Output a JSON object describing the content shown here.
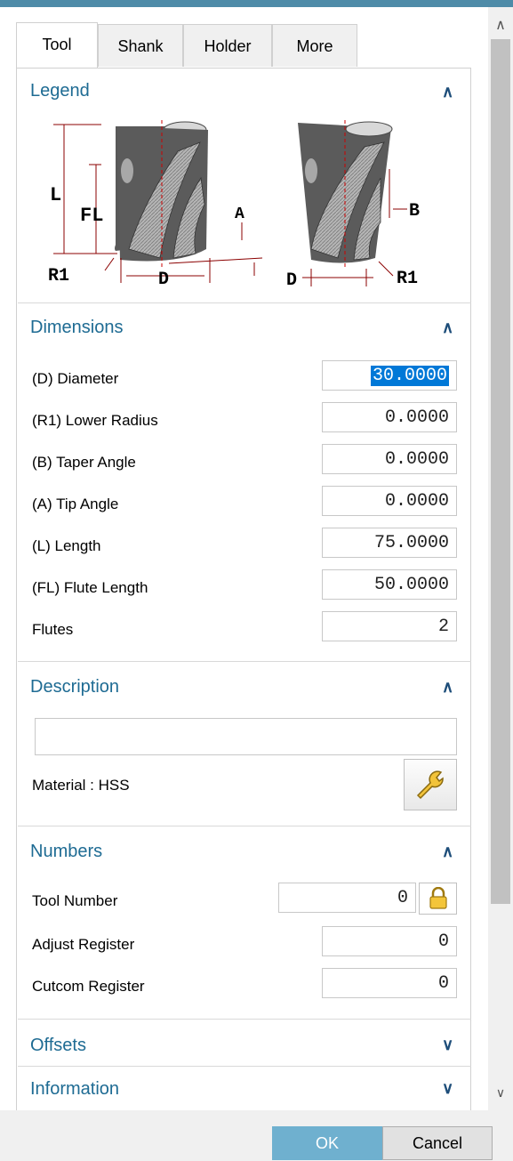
{
  "tabs": [
    {
      "label": "Tool",
      "active": true
    },
    {
      "label": "Shank",
      "active": false
    },
    {
      "label": "Holder",
      "active": false
    },
    {
      "label": "More",
      "active": false
    }
  ],
  "legend": {
    "title": "Legend",
    "labels": {
      "L": "L",
      "FL": "FL",
      "A": "A",
      "R1_left": "R1",
      "D_left": "D",
      "B": "B",
      "D_right": "D",
      "R1_right": "R1"
    }
  },
  "dimensions": {
    "title": "Dimensions",
    "rows": [
      {
        "label": "(D) Diameter",
        "value": "30.0000",
        "selected": true
      },
      {
        "label": "(R1) Lower Radius",
        "value": "0.0000"
      },
      {
        "label": "(B) Taper Angle",
        "value": "0.0000"
      },
      {
        "label": "(A) Tip Angle",
        "value": "0.0000"
      },
      {
        "label": "(L) Length",
        "value": "75.0000"
      },
      {
        "label": "(FL) Flute Length",
        "value": "50.0000"
      },
      {
        "label": "Flutes",
        "value": "2"
      }
    ]
  },
  "description": {
    "title": "Description",
    "value": "",
    "material_label": "Material : HSS"
  },
  "numbers": {
    "title": "Numbers",
    "rows": [
      {
        "label": "Tool Number",
        "value": "0"
      },
      {
        "label": "Adjust Register",
        "value": "0"
      },
      {
        "label": "Cutcom Register",
        "value": "0"
      }
    ]
  },
  "offsets": {
    "title": "Offsets"
  },
  "information": {
    "title": "Information"
  },
  "icons": {
    "expanded": "caret-up-icon",
    "collapsed": "caret-down-icon",
    "wrench": "wrench-icon",
    "lock": "lock-icon"
  },
  "buttons": {
    "ok": "OK",
    "cancel": "Cancel"
  },
  "colors": {
    "accent": "#1e6b93",
    "ok_button": "#6fb0cf",
    "topbar": "#4e8ba8",
    "selection": "#0078d7"
  }
}
